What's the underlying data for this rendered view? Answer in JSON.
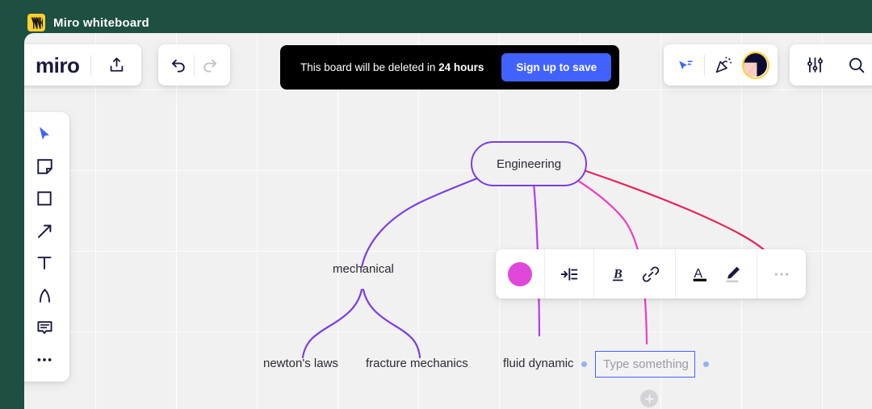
{
  "window": {
    "title": "Miro whiteboard",
    "logo_icon": "miro-logo-icon"
  },
  "toolbar_brand": {
    "wordmark": "miro",
    "share_icon": "upload-share-icon"
  },
  "toolbar_history": {
    "undo_icon": "undo-icon",
    "redo_icon": "redo-icon"
  },
  "banner": {
    "message_prefix": "This board will be deleted in ",
    "message_highlight": "24 hours",
    "signup_label": "Sign up to save"
  },
  "toolbar_collab": {
    "cursor_icon": "pointer-share-icon",
    "celebrate_icon": "party-popper-icon",
    "avatar_icon": "user-avatar"
  },
  "toolbar_utility": {
    "settings_icon": "sliders-icon",
    "search_icon": "search-icon"
  },
  "tools": [
    {
      "name": "select-tool",
      "icon": "cursor-icon",
      "selected": true
    },
    {
      "name": "sticky-tool",
      "icon": "sticky-note-icon",
      "selected": false
    },
    {
      "name": "shape-tool",
      "icon": "square-icon",
      "selected": false
    },
    {
      "name": "arrow-tool",
      "icon": "arrow-icon",
      "selected": false
    },
    {
      "name": "text-tool",
      "icon": "text-t-icon",
      "selected": false
    },
    {
      "name": "pen-tool",
      "icon": "pen-nib-icon",
      "selected": false
    },
    {
      "name": "comment-tool",
      "icon": "comment-icon",
      "selected": false
    },
    {
      "name": "more-tools",
      "icon": "ellipsis-icon",
      "selected": false
    }
  ],
  "format_toolbar": {
    "color_swatch": "#E048DC",
    "color_icon": "color-circle-icon",
    "layout_icon": "indent-layout-icon",
    "bold_label": "B",
    "bold_icon": "bold-icon",
    "link_icon": "link-chain-icon",
    "text_color_label": "A",
    "text_color_icon": "text-color-icon",
    "text_color_value": "#000000",
    "highlight_icon": "highlighter-pen-icon",
    "highlight_value": "#cfcfd4",
    "more_icon": "ellipsis-icon"
  },
  "mindmap": {
    "root": {
      "label": "Engineering",
      "border_color": "#7B3FE4"
    },
    "nodes": [
      {
        "label": "mechanical"
      },
      {
        "label": "newton's laws"
      },
      {
        "label": "fracture mechanics"
      },
      {
        "label": "fluid dynamic"
      }
    ],
    "active_node": {
      "placeholder": "Type something",
      "value": "",
      "border_color": "#4262FF"
    },
    "add_button_icon": "plus-icon",
    "edge_colors": {
      "purple": "#7B3FE4",
      "violet": "#B93CE8",
      "magenta": "#F03CC0",
      "crimson": "#E8245C"
    }
  }
}
